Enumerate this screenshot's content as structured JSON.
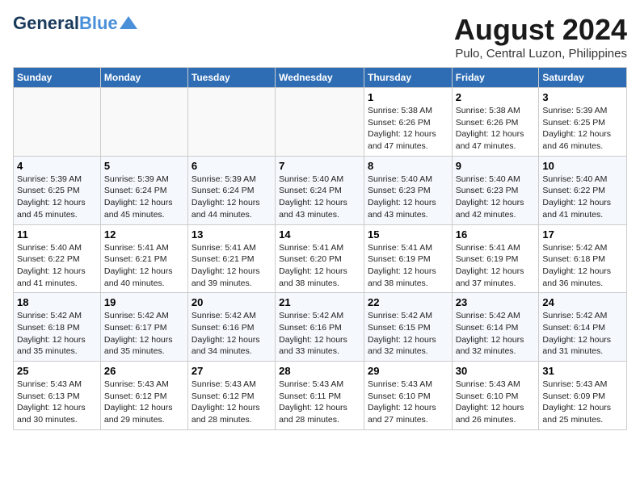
{
  "header": {
    "logo_general": "General",
    "logo_blue": "Blue",
    "month_year": "August 2024",
    "location": "Pulo, Central Luzon, Philippines"
  },
  "days_of_week": [
    "Sunday",
    "Monday",
    "Tuesday",
    "Wednesday",
    "Thursday",
    "Friday",
    "Saturday"
  ],
  "weeks": [
    [
      {
        "day": "",
        "info": ""
      },
      {
        "day": "",
        "info": ""
      },
      {
        "day": "",
        "info": ""
      },
      {
        "day": "",
        "info": ""
      },
      {
        "day": "1",
        "info": "Sunrise: 5:38 AM\nSunset: 6:26 PM\nDaylight: 12 hours\nand 47 minutes."
      },
      {
        "day": "2",
        "info": "Sunrise: 5:38 AM\nSunset: 6:26 PM\nDaylight: 12 hours\nand 47 minutes."
      },
      {
        "day": "3",
        "info": "Sunrise: 5:39 AM\nSunset: 6:25 PM\nDaylight: 12 hours\nand 46 minutes."
      }
    ],
    [
      {
        "day": "4",
        "info": "Sunrise: 5:39 AM\nSunset: 6:25 PM\nDaylight: 12 hours\nand 45 minutes."
      },
      {
        "day": "5",
        "info": "Sunrise: 5:39 AM\nSunset: 6:24 PM\nDaylight: 12 hours\nand 45 minutes."
      },
      {
        "day": "6",
        "info": "Sunrise: 5:39 AM\nSunset: 6:24 PM\nDaylight: 12 hours\nand 44 minutes."
      },
      {
        "day": "7",
        "info": "Sunrise: 5:40 AM\nSunset: 6:24 PM\nDaylight: 12 hours\nand 43 minutes."
      },
      {
        "day": "8",
        "info": "Sunrise: 5:40 AM\nSunset: 6:23 PM\nDaylight: 12 hours\nand 43 minutes."
      },
      {
        "day": "9",
        "info": "Sunrise: 5:40 AM\nSunset: 6:23 PM\nDaylight: 12 hours\nand 42 minutes."
      },
      {
        "day": "10",
        "info": "Sunrise: 5:40 AM\nSunset: 6:22 PM\nDaylight: 12 hours\nand 41 minutes."
      }
    ],
    [
      {
        "day": "11",
        "info": "Sunrise: 5:40 AM\nSunset: 6:22 PM\nDaylight: 12 hours\nand 41 minutes."
      },
      {
        "day": "12",
        "info": "Sunrise: 5:41 AM\nSunset: 6:21 PM\nDaylight: 12 hours\nand 40 minutes."
      },
      {
        "day": "13",
        "info": "Sunrise: 5:41 AM\nSunset: 6:21 PM\nDaylight: 12 hours\nand 39 minutes."
      },
      {
        "day": "14",
        "info": "Sunrise: 5:41 AM\nSunset: 6:20 PM\nDaylight: 12 hours\nand 38 minutes."
      },
      {
        "day": "15",
        "info": "Sunrise: 5:41 AM\nSunset: 6:19 PM\nDaylight: 12 hours\nand 38 minutes."
      },
      {
        "day": "16",
        "info": "Sunrise: 5:41 AM\nSunset: 6:19 PM\nDaylight: 12 hours\nand 37 minutes."
      },
      {
        "day": "17",
        "info": "Sunrise: 5:42 AM\nSunset: 6:18 PM\nDaylight: 12 hours\nand 36 minutes."
      }
    ],
    [
      {
        "day": "18",
        "info": "Sunrise: 5:42 AM\nSunset: 6:18 PM\nDaylight: 12 hours\nand 35 minutes."
      },
      {
        "day": "19",
        "info": "Sunrise: 5:42 AM\nSunset: 6:17 PM\nDaylight: 12 hours\nand 35 minutes."
      },
      {
        "day": "20",
        "info": "Sunrise: 5:42 AM\nSunset: 6:16 PM\nDaylight: 12 hours\nand 34 minutes."
      },
      {
        "day": "21",
        "info": "Sunrise: 5:42 AM\nSunset: 6:16 PM\nDaylight: 12 hours\nand 33 minutes."
      },
      {
        "day": "22",
        "info": "Sunrise: 5:42 AM\nSunset: 6:15 PM\nDaylight: 12 hours\nand 32 minutes."
      },
      {
        "day": "23",
        "info": "Sunrise: 5:42 AM\nSunset: 6:14 PM\nDaylight: 12 hours\nand 32 minutes."
      },
      {
        "day": "24",
        "info": "Sunrise: 5:42 AM\nSunset: 6:14 PM\nDaylight: 12 hours\nand 31 minutes."
      }
    ],
    [
      {
        "day": "25",
        "info": "Sunrise: 5:43 AM\nSunset: 6:13 PM\nDaylight: 12 hours\nand 30 minutes."
      },
      {
        "day": "26",
        "info": "Sunrise: 5:43 AM\nSunset: 6:12 PM\nDaylight: 12 hours\nand 29 minutes."
      },
      {
        "day": "27",
        "info": "Sunrise: 5:43 AM\nSunset: 6:12 PM\nDaylight: 12 hours\nand 28 minutes."
      },
      {
        "day": "28",
        "info": "Sunrise: 5:43 AM\nSunset: 6:11 PM\nDaylight: 12 hours\nand 28 minutes."
      },
      {
        "day": "29",
        "info": "Sunrise: 5:43 AM\nSunset: 6:10 PM\nDaylight: 12 hours\nand 27 minutes."
      },
      {
        "day": "30",
        "info": "Sunrise: 5:43 AM\nSunset: 6:10 PM\nDaylight: 12 hours\nand 26 minutes."
      },
      {
        "day": "31",
        "info": "Sunrise: 5:43 AM\nSunset: 6:09 PM\nDaylight: 12 hours\nand 25 minutes."
      }
    ]
  ]
}
